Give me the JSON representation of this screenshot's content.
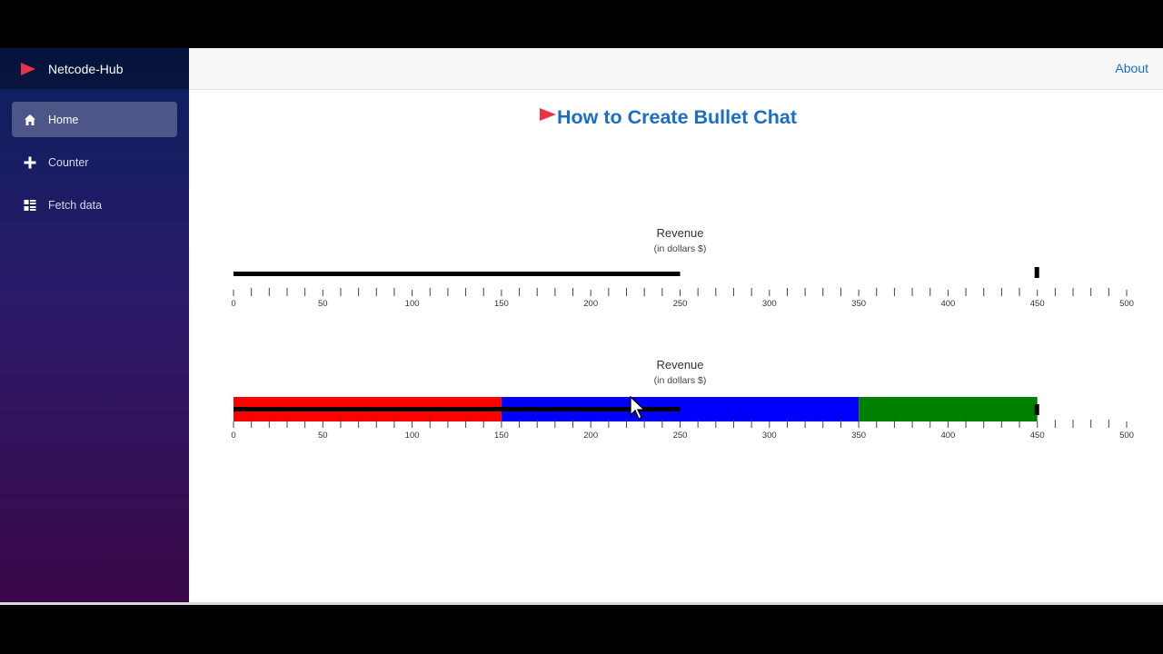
{
  "brand": {
    "title": "Netcode-Hub",
    "icon": "play-triangle-icon",
    "color": "#e8344a"
  },
  "sidebar": {
    "items": [
      {
        "label": "Home",
        "icon": "home-icon",
        "active": true
      },
      {
        "label": "Counter",
        "icon": "plus-icon",
        "active": false
      },
      {
        "label": "Fetch data",
        "icon": "list-icon",
        "active": false
      }
    ]
  },
  "topbar": {
    "about_label": "About"
  },
  "page": {
    "title": "How to Create Bullet Chat",
    "title_color": "#1b6ec2"
  },
  "chart_data": [
    {
      "type": "bullet",
      "title": "Revenue",
      "subtitle": "(in dollars $)",
      "xlim": [
        0,
        500
      ],
      "ticks": [
        0,
        50,
        100,
        150,
        200,
        250,
        300,
        350,
        400,
        450,
        500
      ],
      "ranges": [],
      "measure": 250,
      "target": 450
    },
    {
      "type": "bullet",
      "title": "Revenue",
      "subtitle": "(in dollars $)",
      "xlim": [
        0,
        500
      ],
      "ticks": [
        0,
        50,
        100,
        150,
        200,
        250,
        300,
        350,
        400,
        450,
        500
      ],
      "ranges": [
        {
          "from": 0,
          "to": 150,
          "color": "#ff0000"
        },
        {
          "from": 150,
          "to": 350,
          "color": "#0000ff"
        },
        {
          "from": 350,
          "to": 450,
          "color": "#008000"
        }
      ],
      "measure": 250,
      "target": 450
    }
  ]
}
